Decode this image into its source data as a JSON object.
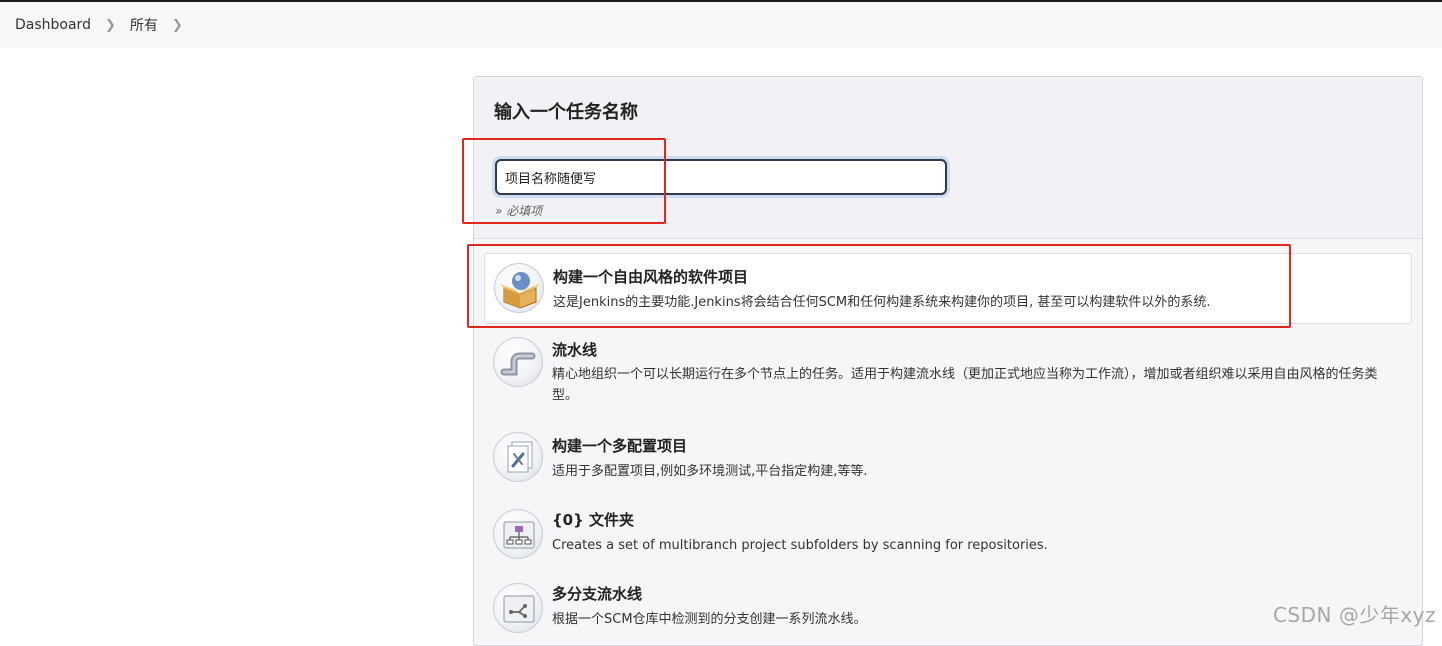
{
  "breadcrumb": {
    "items": [
      "Dashboard",
      "所有"
    ]
  },
  "new_item": {
    "heading": "输入一个任务名称",
    "name_value": "项目名称随便写",
    "required_hint": "» 必填项"
  },
  "job_types": [
    {
      "title": "构建一个自由风格的软件项目",
      "description": "这是Jenkins的主要功能.Jenkins将会结合任何SCM和任何构建系统来构建你的项目, 甚至可以构建软件以外的系统.",
      "icon": "freestyle-package-icon"
    },
    {
      "title": "流水线",
      "description": "精心地组织一个可以长期运行在多个节点上的任务。适用于构建流水线（更加正式地应当称为工作流），增加或者组织难以采用自由风格的任务类型。",
      "icon": "pipeline-icon"
    },
    {
      "title": "构建一个多配置项目",
      "description": "适用于多配置项目,例如多环境测试,平台指定构建,等等.",
      "icon": "multi-config-icon"
    },
    {
      "title": "{0} 文件夹",
      "description": "Creates a set of multibranch project subfolders by scanning for repositories.",
      "icon": "folder-icon"
    },
    {
      "title": "多分支流水线",
      "description": "根据一个SCM仓库中检测到的分支创建一系列流水线。",
      "icon": "multibranch-pipeline-icon"
    }
  ],
  "watermark": "CSDN @少年xyz"
}
